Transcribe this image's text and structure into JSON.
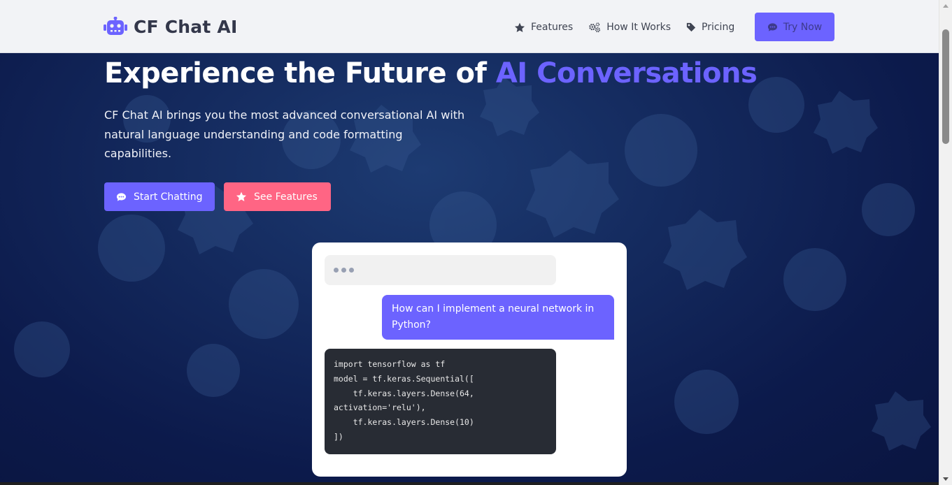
{
  "nav": {
    "brand": "CF Chat AI",
    "links": [
      {
        "label": "Features",
        "icon": "star-icon"
      },
      {
        "label": "How It Works",
        "icon": "gears-icon"
      },
      {
        "label": "Pricing",
        "icon": "tag-icon"
      }
    ],
    "cta_label": "Try Now"
  },
  "hero": {
    "title_main": "Experience the Future of ",
    "title_accent": "AI Conversations",
    "subtitle": "CF Chat AI brings you the most advanced conversational AI with natural language understanding and code formatting capabilities.",
    "buttons": {
      "primary": "Start Chatting",
      "secondary": "See Features"
    }
  },
  "chat_demo": {
    "user_message": "How can I implement a neural network in Python?",
    "code": "import tensorflow as tf\nmodel = tf.keras.Sequential([\n    tf.keras.layers.Dense(64,\nactivation='relu'),\n    tf.keras.layers.Dense(10)\n])"
  },
  "colors": {
    "accent": "#6c63ff",
    "secondary": "#ff6584",
    "code_bg": "#282c34",
    "nav_bg": "#f2f3f6"
  }
}
